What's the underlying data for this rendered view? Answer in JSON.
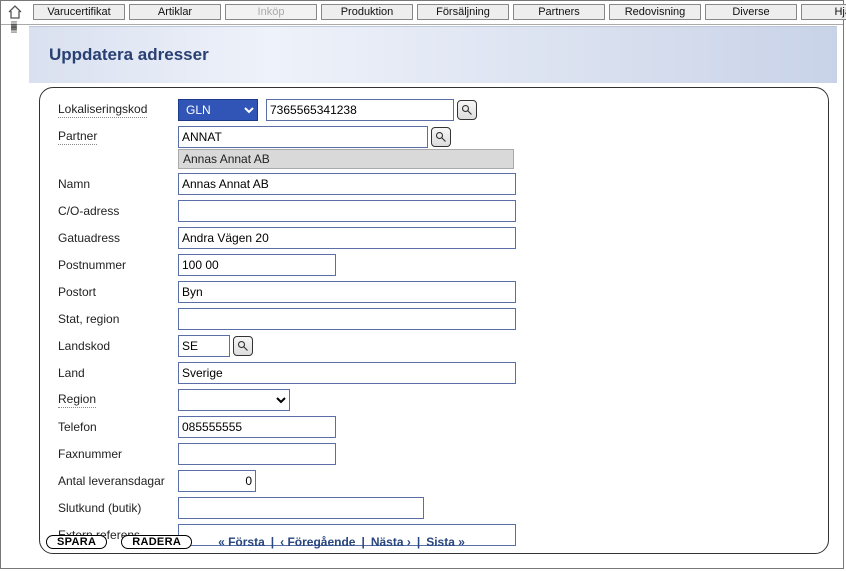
{
  "tabs": [
    {
      "label": "Varucertifikat",
      "disabled": false
    },
    {
      "label": "Artiklar",
      "disabled": false
    },
    {
      "label": "Inköp",
      "disabled": true
    },
    {
      "label": "Produktion",
      "disabled": false
    },
    {
      "label": "Försäljning",
      "disabled": false
    },
    {
      "label": "Partners",
      "disabled": false
    },
    {
      "label": "Redovisning",
      "disabled": false
    },
    {
      "label": "Diverse",
      "disabled": false
    },
    {
      "label": "Hjälp",
      "disabled": false
    }
  ],
  "title": "Uppdatera adresser",
  "labels": {
    "lokaliseringskod": "Lokaliseringskod",
    "partner": "Partner",
    "namn": "Namn",
    "coadress": "C/O-adress",
    "gatuadress": "Gatuadress",
    "postnummer": "Postnummer",
    "postort": "Postort",
    "stat_region": "Stat, region",
    "landskod": "Landskod",
    "land": "Land",
    "region": "Region",
    "telefon": "Telefon",
    "faxnummer": "Faxnummer",
    "antal_leveransdagar": "Antal leveransdagar",
    "slutkund": "Slutkund (butik)",
    "extern_ref": "Extern referens"
  },
  "values": {
    "lok_type": "GLN",
    "lok_code": "7365565341238",
    "partner": "ANNAT",
    "partner_suggest": "Annas Annat AB",
    "namn": "Annas Annat AB",
    "coadress": "",
    "gatuadress": "Andra Vägen 20",
    "postnummer": "100 00",
    "postort": "Byn",
    "stat_region": "",
    "landskod": "SE",
    "land": "Sverige",
    "region": "",
    "telefon": "085555555",
    "faxnummer": "",
    "antal_leveransdagar": "0",
    "slutkund": "",
    "extern_ref": ""
  },
  "buttons": {
    "spara": "SPARA",
    "radera": "RADERA"
  },
  "pager": {
    "first": "« Första",
    "prev": "‹ Föregående",
    "next": "Nästa ›",
    "last": "Sista »",
    "sep": "|"
  }
}
